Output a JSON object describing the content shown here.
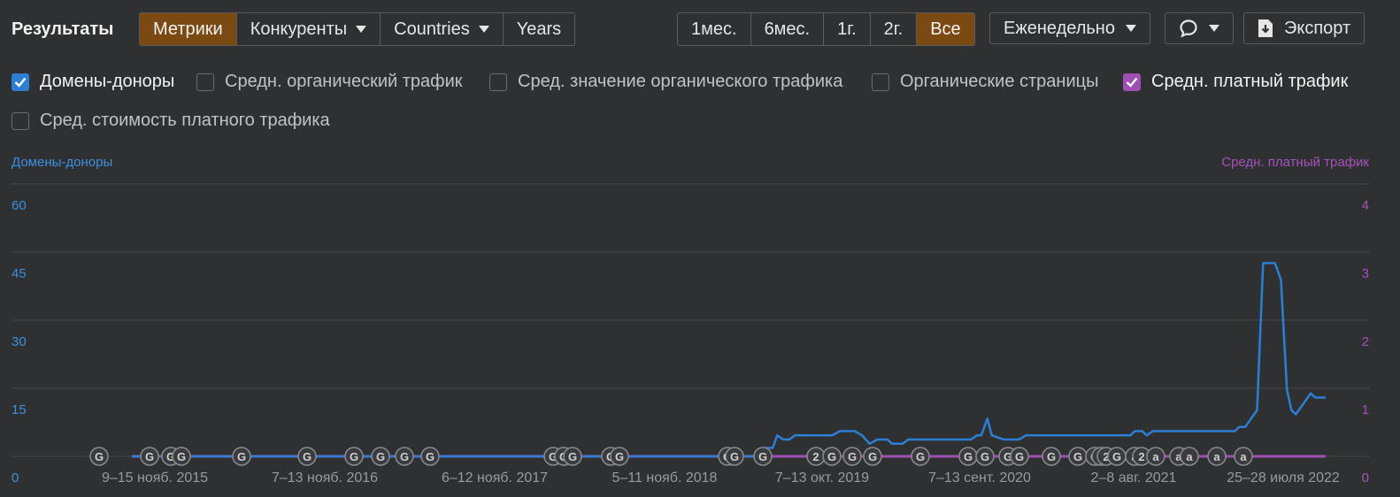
{
  "header": {
    "title": "Результаты",
    "view_tabs": [
      {
        "label": "Метрики",
        "active": true,
        "dropdown": false
      },
      {
        "label": "Конкуренты",
        "active": false,
        "dropdown": true
      },
      {
        "label": "Countries",
        "active": false,
        "dropdown": true
      },
      {
        "label": "Years",
        "active": false,
        "dropdown": false
      }
    ],
    "period_tabs": [
      {
        "label": "1мес.",
        "active": false
      },
      {
        "label": "6мес.",
        "active": false
      },
      {
        "label": "1г.",
        "active": false
      },
      {
        "label": "2г.",
        "active": false
      },
      {
        "label": "Все",
        "active": true
      }
    ],
    "interval_label": "Еженедельно",
    "export_label": "Экспорт"
  },
  "metrics": [
    {
      "label": "Домены-доноры",
      "checked": true,
      "color": "#2d7fd6"
    },
    {
      "label": "Средн. органический трафик",
      "checked": false
    },
    {
      "label": "Сред. значение органического трафика",
      "checked": false
    },
    {
      "label": "Органические страницы",
      "checked": false
    },
    {
      "label": "Средн. платный трафик",
      "checked": true,
      "color": "#9d4fb3"
    },
    {
      "label": "Сред. стоимость платного трафика",
      "checked": false
    }
  ],
  "colors": {
    "accent": "#7a4a12",
    "left_axis": "#3d8fe0",
    "right_axis": "#a552bd",
    "series_blue": "#2d7fd6",
    "series_purple": "#9d4fb3"
  },
  "chart_data": {
    "type": "line",
    "y_left_label": "Домены-доноры",
    "y_right_label": "Средн. платный трафик",
    "y_left_ticks": [
      "60",
      "45",
      "30",
      "15",
      "0"
    ],
    "y_right_ticks": [
      "4",
      "3",
      "2",
      "1",
      "0"
    ],
    "ylim_left": [
      0,
      60
    ],
    "ylim_right": [
      0,
      4
    ],
    "x_ticks": [
      "9–15 нояб. 2015",
      "7–13 нояб. 2016",
      "6–12 нояб. 2017",
      "5–11 нояб. 2018",
      "7–13 окт. 2019",
      "7–13 сент. 2020",
      "2–8 авг. 2021",
      "25–28 июля 2022"
    ],
    "grid": true,
    "series": [
      {
        "name": "Домены-доноры",
        "axis": "left",
        "points": [
          [
            2015.35,
            0
          ],
          [
            2019.55,
            0
          ],
          [
            2019.6,
            2
          ],
          [
            2019.65,
            2
          ],
          [
            2019.68,
            5
          ],
          [
            2019.72,
            4
          ],
          [
            2019.76,
            4
          ],
          [
            2019.8,
            5
          ],
          [
            2019.9,
            5
          ],
          [
            2020.05,
            5
          ],
          [
            2020.1,
            6
          ],
          [
            2020.2,
            6
          ],
          [
            2020.25,
            5
          ],
          [
            2020.3,
            3
          ],
          [
            2020.35,
            4
          ],
          [
            2020.42,
            4
          ],
          [
            2020.45,
            3
          ],
          [
            2020.52,
            3
          ],
          [
            2020.56,
            4
          ],
          [
            2020.7,
            4
          ],
          [
            2020.85,
            4
          ],
          [
            2020.98,
            4
          ],
          [
            2021.02,
            5
          ],
          [
            2021.05,
            5
          ],
          [
            2021.09,
            9
          ],
          [
            2021.12,
            5
          ],
          [
            2021.2,
            4
          ],
          [
            2021.3,
            4
          ],
          [
            2021.35,
            5
          ],
          [
            2021.5,
            5
          ],
          [
            2021.8,
            5
          ],
          [
            2022.05,
            5
          ],
          [
            2022.08,
            6
          ],
          [
            2022.13,
            6
          ],
          [
            2022.16,
            5
          ],
          [
            2022.2,
            6
          ],
          [
            2022.4,
            6
          ],
          [
            2022.75,
            6
          ],
          [
            2022.78,
            7
          ],
          [
            2022.82,
            7
          ],
          [
            2022.86,
            9
          ],
          [
            2022.9,
            11
          ],
          [
            2022.94,
            46
          ],
          [
            2022.97,
            46
          ],
          [
            2023.02,
            46
          ],
          [
            2023.06,
            42
          ],
          [
            2023.1,
            16
          ],
          [
            2023.13,
            11
          ],
          [
            2023.16,
            10
          ],
          [
            2023.22,
            13
          ],
          [
            2023.26,
            15
          ],
          [
            2023.29,
            14
          ],
          [
            2023.36,
            14
          ]
        ]
      },
      {
        "name": "Средн. платный трафик",
        "axis": "right",
        "points": [
          [
            2015.35,
            0
          ],
          [
            2023.36,
            0
          ]
        ]
      }
    ],
    "annotations": [
      "G",
      "G",
      "G",
      "G",
      "G",
      "G",
      "G",
      "G",
      "G",
      "G",
      "G",
      "G",
      "G",
      "G",
      "G",
      "G",
      "G",
      "G",
      "2",
      "G",
      "G",
      "G",
      "G",
      "G",
      "G",
      "G",
      "G",
      "G",
      "G",
      "G",
      "a",
      "2",
      "G",
      "a",
      "2",
      "a",
      "a",
      "a",
      "a",
      "a"
    ]
  }
}
